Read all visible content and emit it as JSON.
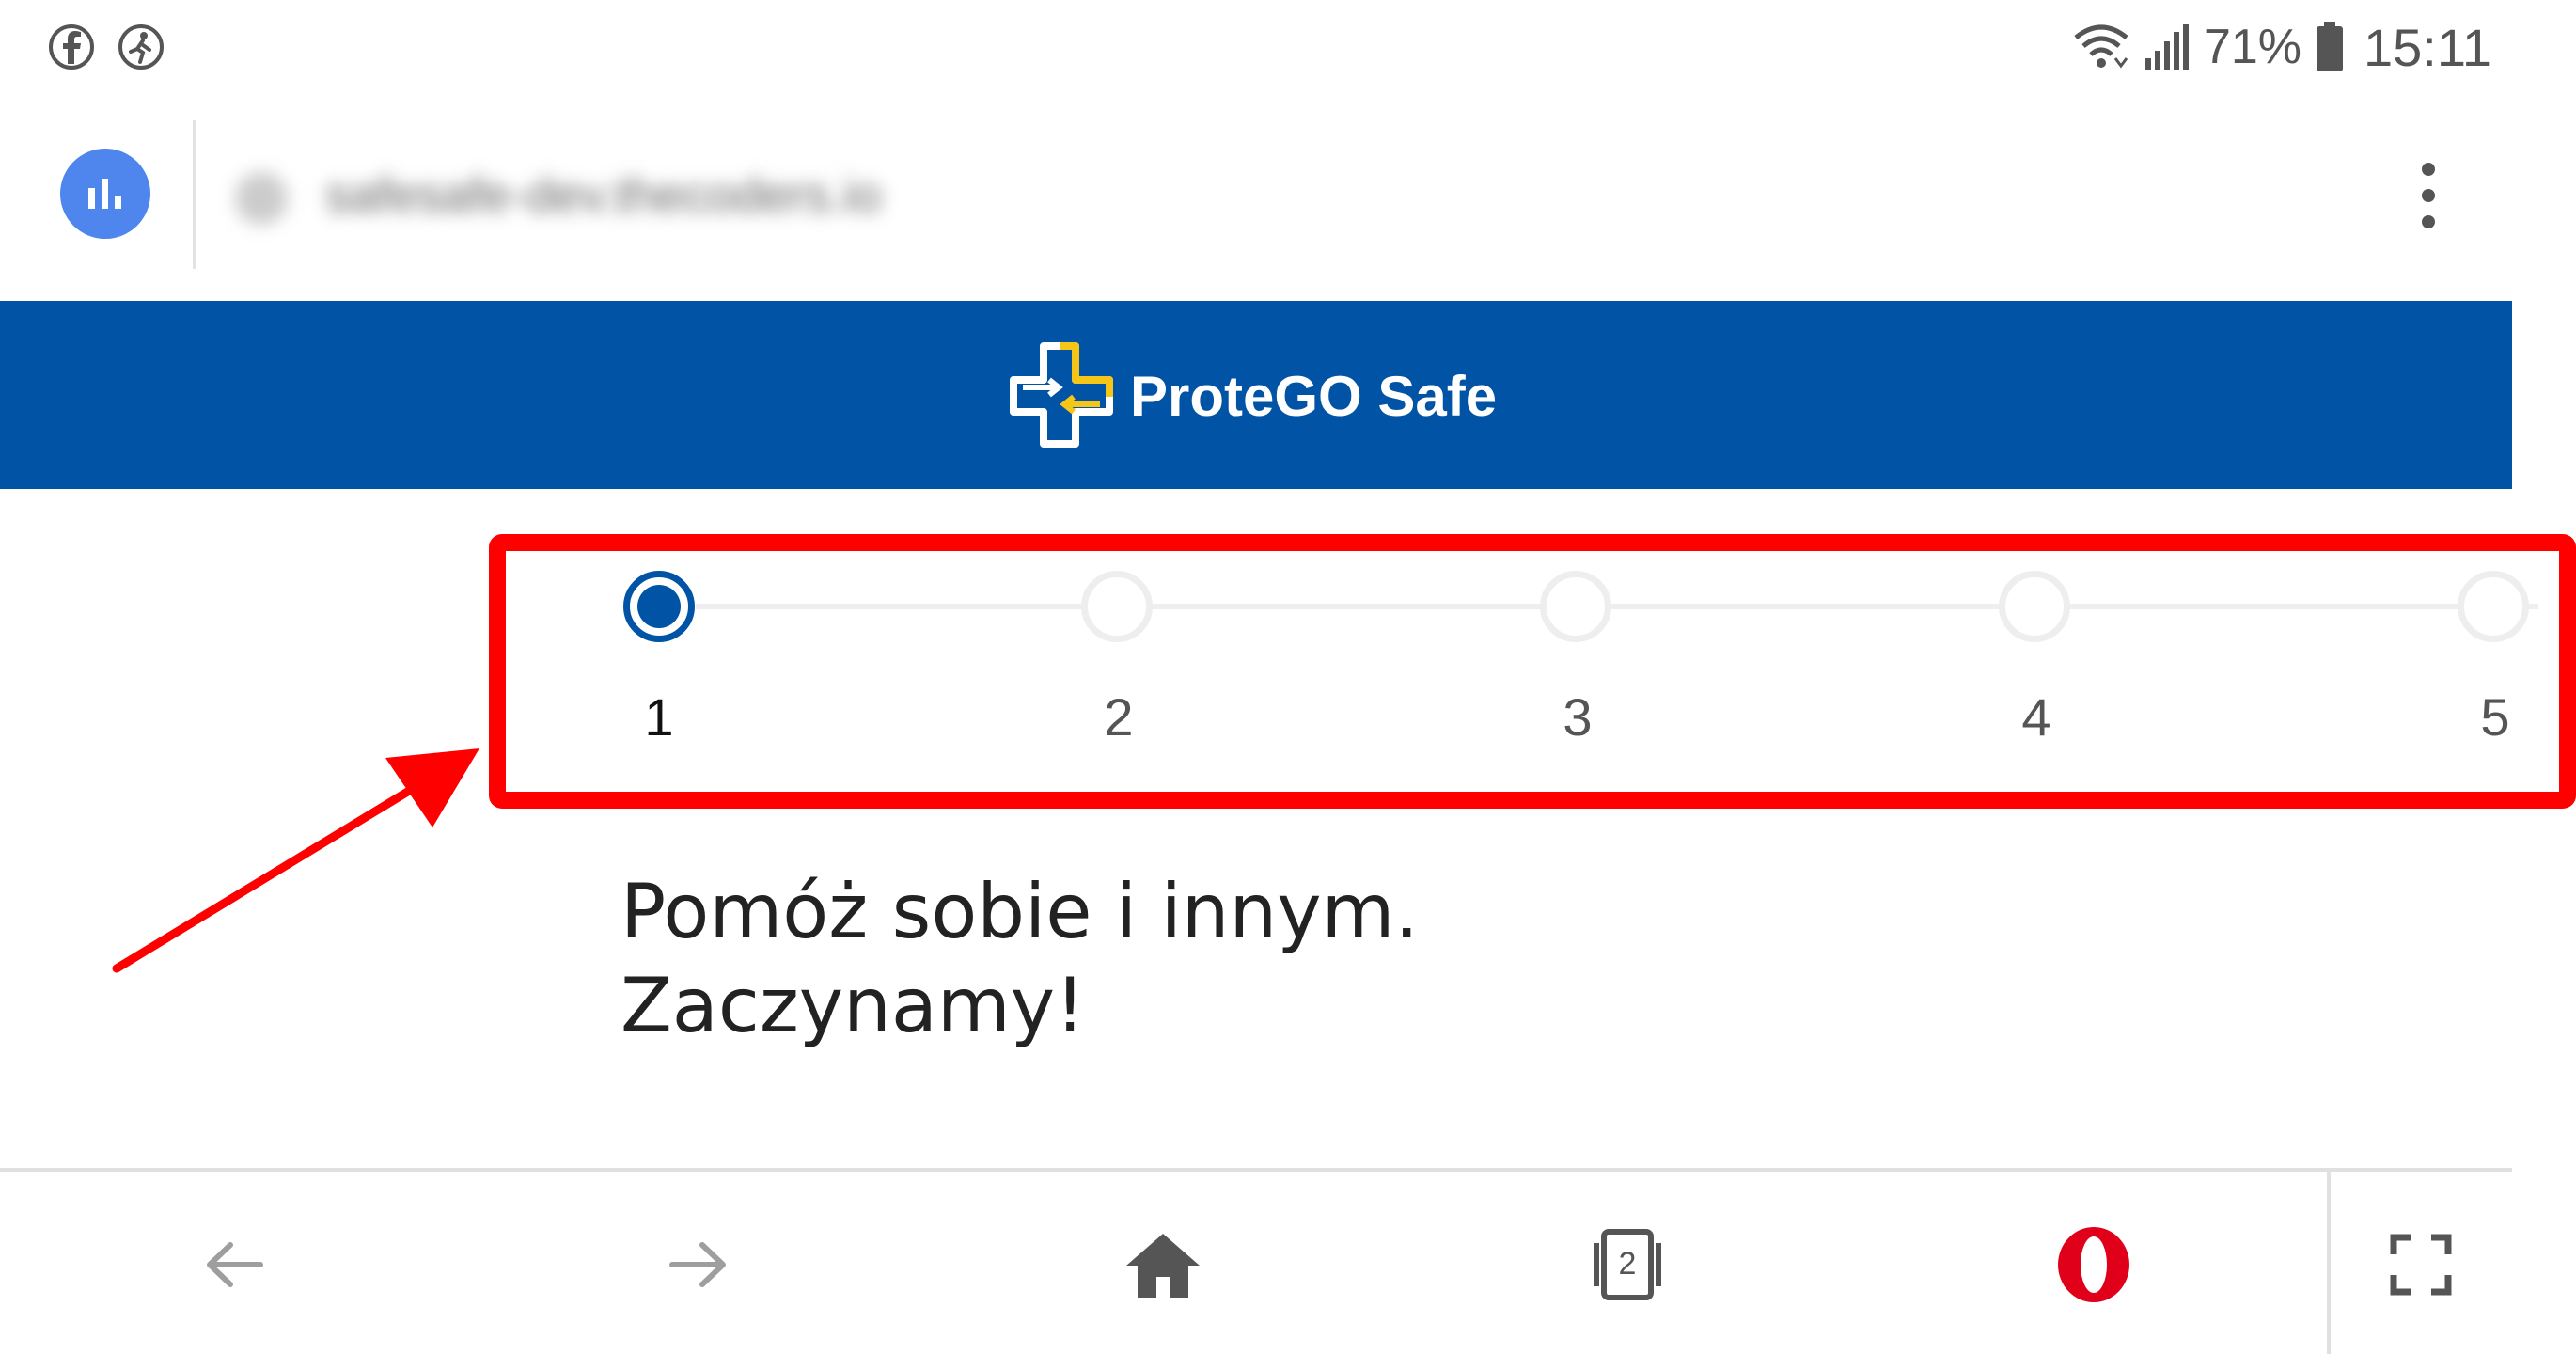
{
  "status_bar": {
    "battery_percent": "71%",
    "time": "15:11",
    "left_icons": [
      "facebook-icon",
      "fitness-icon"
    ],
    "right_icons": [
      "wifi-icon",
      "signal-icon",
      "battery-icon"
    ]
  },
  "address_bar": {
    "url": "safesafe-dev.thecoders.io",
    "site_icon": "bar-chart-icon",
    "menu_icon": "more-vertical-icon"
  },
  "header": {
    "title": "ProteGO Safe",
    "logo_icon": "protego-cross-logo",
    "background": "#0153a6"
  },
  "stepper": {
    "steps": [
      "1",
      "2",
      "3",
      "4",
      "5"
    ],
    "active_step": "1",
    "accent": "#0153a6"
  },
  "annotation": {
    "color": "#ff0000"
  },
  "content": {
    "headline_line1": "Pomóż sobie i innym.",
    "headline_line2": "Zaczynamy!"
  },
  "bottom_nav": {
    "tab_count": "2",
    "items": [
      "back-icon",
      "forward-icon",
      "home-icon",
      "tabs-icon",
      "opera-icon",
      "fullscreen-icon"
    ]
  }
}
